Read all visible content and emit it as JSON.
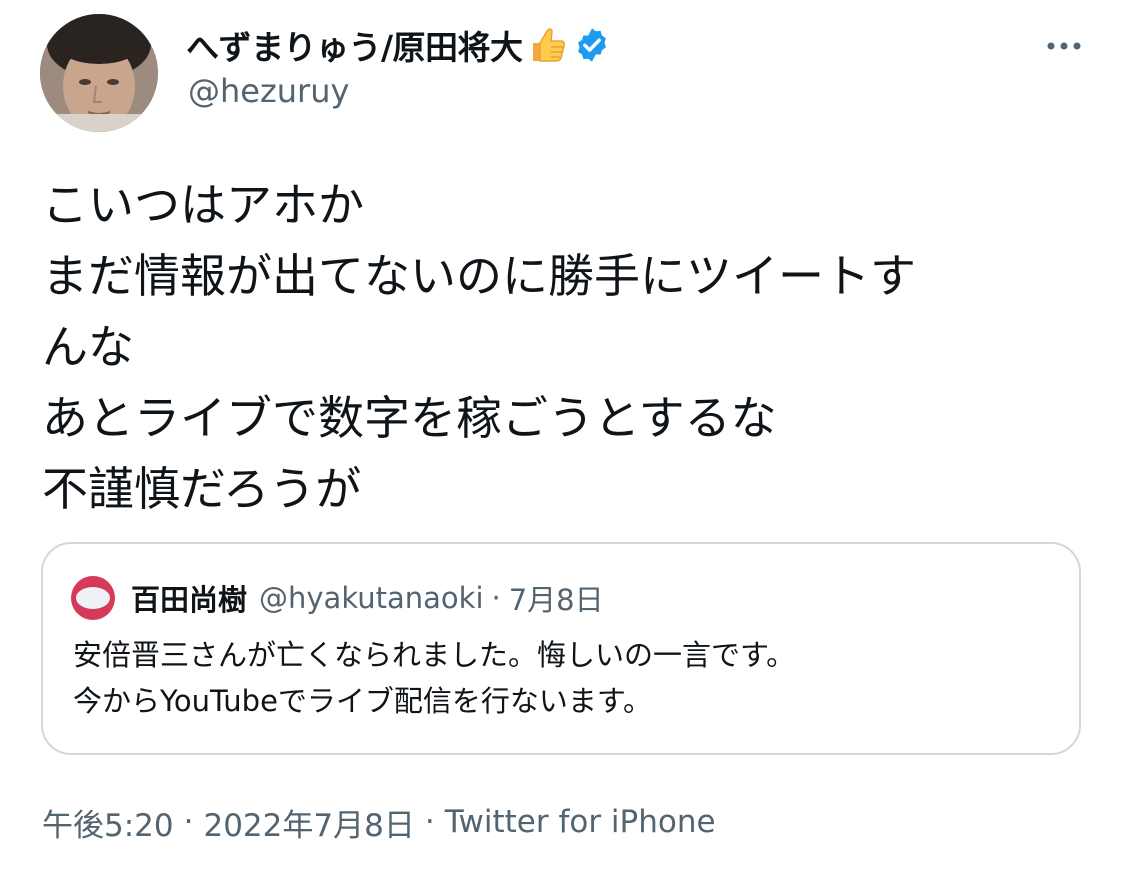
{
  "author": {
    "display_name": "へずまりゅう/原田将大",
    "handle": "@hezuruy",
    "verified": true,
    "name_emoji": "thumbs-up-icon"
  },
  "tweet": {
    "lines": [
      "こいつはアホか",
      "まだ情報が出てないのに勝手にツイートす",
      "んな",
      "あとライブで数字を稼ごうとするな",
      "不謹慎だろうが"
    ]
  },
  "quote": {
    "name": "百田尚樹",
    "handle": "@hyakutanaoki",
    "separator": "·",
    "date": "7月8日",
    "lines": [
      "安倍晋三さんが亡くなられました。悔しいの一言です。",
      "今からYouTubeでライブ配信を行ないます。"
    ]
  },
  "meta": {
    "time": "午後5:20",
    "separator": "·",
    "date": "2022年7月8日",
    "source": "Twitter for iPhone"
  },
  "colors": {
    "text_primary": "#0f1419",
    "text_secondary": "#536471",
    "verified_blue": "#1d9bf0",
    "border": "#cfd9de"
  }
}
